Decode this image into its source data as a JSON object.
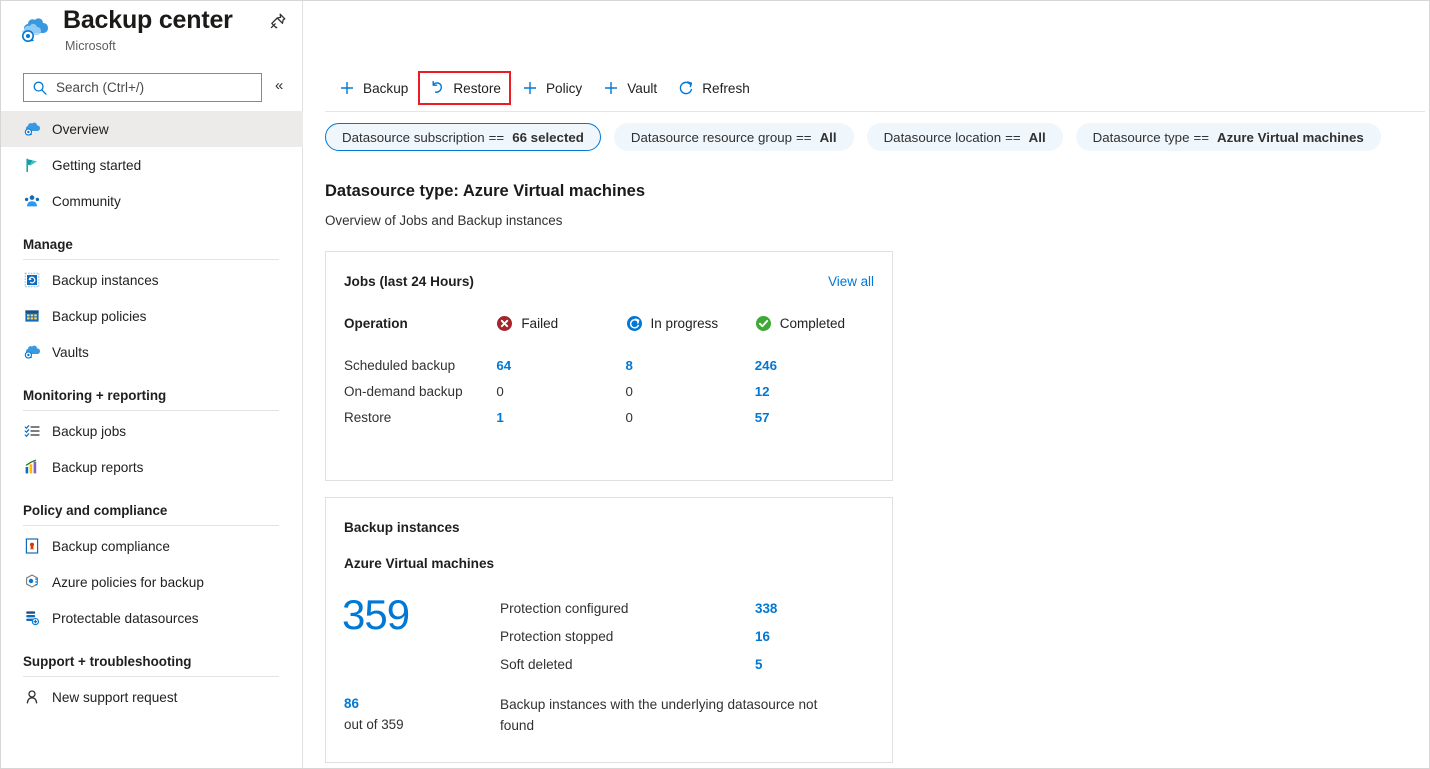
{
  "blade": {
    "title": "Backup center",
    "subtitle": "Microsoft",
    "pin_icon": "pin-icon",
    "ellipsis_icon": "ellipsis-icon",
    "collapse_icon": "chevron-double-left-icon"
  },
  "search": {
    "placeholder": "Search (Ctrl+/)",
    "value": "",
    "icon": "search-icon"
  },
  "sidebar": {
    "items": [
      {
        "label": "Overview",
        "icon": "backup-center-icon",
        "selected": true
      },
      {
        "label": "Getting started",
        "icon": "flag-icon",
        "selected": false
      },
      {
        "label": "Community",
        "icon": "community-icon",
        "selected": false
      }
    ],
    "sections": [
      {
        "header": "Manage",
        "items": [
          {
            "label": "Backup instances",
            "icon": "backup-instances-icon"
          },
          {
            "label": "Backup policies",
            "icon": "backup-policies-icon"
          },
          {
            "label": "Vaults",
            "icon": "vault-icon"
          }
        ]
      },
      {
        "header": "Monitoring + reporting",
        "items": [
          {
            "label": "Backup jobs",
            "icon": "backup-jobs-icon"
          },
          {
            "label": "Backup reports",
            "icon": "backup-reports-icon"
          }
        ]
      },
      {
        "header": "Policy and compliance",
        "items": [
          {
            "label": "Backup compliance",
            "icon": "backup-compliance-icon"
          },
          {
            "label": "Azure policies for backup",
            "icon": "azure-policy-icon"
          },
          {
            "label": "Protectable datasources",
            "icon": "protectable-datasources-icon"
          }
        ]
      },
      {
        "header": "Support + troubleshooting",
        "items": [
          {
            "label": "New support request",
            "icon": "support-person-icon"
          }
        ]
      }
    ]
  },
  "toolbar": {
    "buttons": [
      {
        "label": "Backup",
        "icon": "plus-icon",
        "highlighted": false
      },
      {
        "label": "Restore",
        "icon": "restore-arrow-icon",
        "highlighted": true
      },
      {
        "label": "Policy",
        "icon": "plus-icon",
        "highlighted": false
      },
      {
        "label": "Vault",
        "icon": "plus-icon",
        "highlighted": false
      },
      {
        "label": "Refresh",
        "icon": "refresh-icon",
        "highlighted": false
      }
    ],
    "highlight_color": "#ec1c24"
  },
  "filters": [
    {
      "name": "Datasource subscription",
      "operator": "==",
      "value": "66 selected",
      "active": true
    },
    {
      "name": "Datasource resource group",
      "operator": "==",
      "value": "All",
      "active": false
    },
    {
      "name": "Datasource location",
      "operator": "==",
      "value": "All",
      "active": false
    },
    {
      "name": "Datasource type",
      "operator": "==",
      "value": "Azure Virtual machines",
      "active": false
    }
  ],
  "page": {
    "title": "Datasource type: Azure Virtual machines",
    "subtitle": "Overview of Jobs and Backup instances"
  },
  "jobs_card": {
    "title": "Jobs (last 24 Hours)",
    "view_all": "View all",
    "operation_header": "Operation",
    "status_columns": [
      {
        "label": "Failed",
        "icon": "error-circle-icon",
        "color": "#a4262c"
      },
      {
        "label": "In progress",
        "icon": "in-progress-circle-icon",
        "color": "#0078d4"
      },
      {
        "label": "Completed",
        "icon": "success-circle-icon",
        "color": "#107c10"
      }
    ],
    "rows": [
      {
        "operation": "Scheduled backup",
        "failed": "64",
        "in_progress": "8",
        "completed": "246"
      },
      {
        "operation": "On-demand backup",
        "failed": "0",
        "in_progress": "0",
        "completed": "12"
      },
      {
        "operation": "Restore",
        "failed": "1",
        "in_progress": "0",
        "completed": "57"
      }
    ]
  },
  "instances_card": {
    "title": "Backup instances",
    "subtitle": "Azure Virtual machines",
    "total": "359",
    "rows": [
      {
        "label": "Protection configured",
        "value": "338"
      },
      {
        "label": "Protection stopped",
        "value": "16"
      },
      {
        "label": "Soft deleted",
        "value": "5"
      }
    ],
    "not_found": {
      "count": "86",
      "out_of": "out of 359",
      "text": "Backup instances with the underlying datasource not found"
    }
  },
  "colors": {
    "accent": "#0078d4",
    "link": "#0078d4",
    "error": "#a4262c",
    "success": "#107c10",
    "pill_background": "#eff6fc",
    "selected_nav": "#edebe9"
  }
}
